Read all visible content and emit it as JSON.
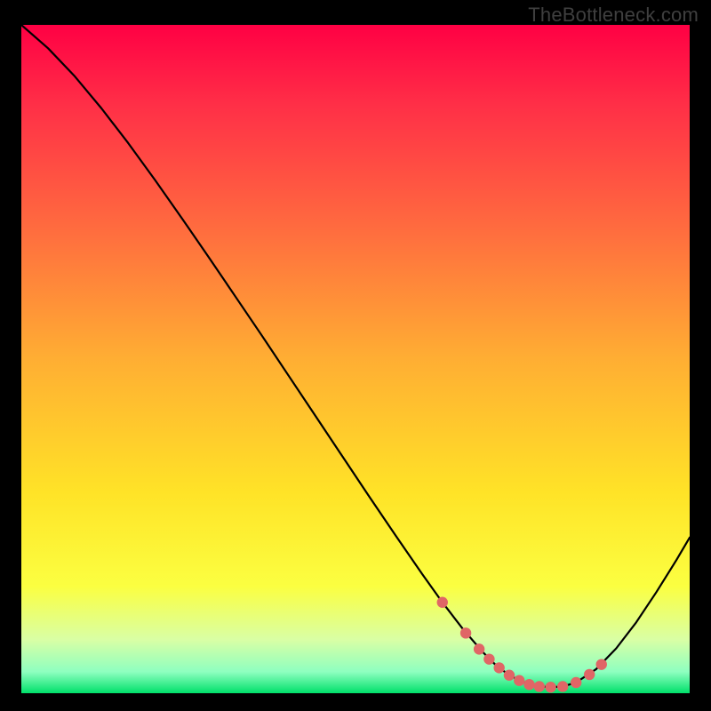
{
  "watermark": "TheBottleneck.com",
  "colors": {
    "dot_fill": "#e06666",
    "curve_stroke": "#000000",
    "gradient_stops": [
      {
        "offset": "0%",
        "color": "#ff0044"
      },
      {
        "offset": "12%",
        "color": "#ff2f47"
      },
      {
        "offset": "30%",
        "color": "#ff6a3f"
      },
      {
        "offset": "50%",
        "color": "#ffae33"
      },
      {
        "offset": "70%",
        "color": "#ffe327"
      },
      {
        "offset": "84%",
        "color": "#fbff41"
      },
      {
        "offset": "92%",
        "color": "#d9ffa5"
      },
      {
        "offset": "96.8%",
        "color": "#8effc0"
      },
      {
        "offset": "100%",
        "color": "#00e06a"
      }
    ]
  },
  "chart_data": {
    "type": "line",
    "title": "",
    "xlabel": "",
    "ylabel": "",
    "xlim": [
      0,
      100
    ],
    "ylim": [
      0,
      100
    ],
    "series": [
      {
        "name": "curve",
        "x": [
          0,
          4,
          8,
          12,
          16,
          20,
          24,
          28,
          32,
          36,
          40,
          44,
          48,
          52,
          56,
          60,
          63,
          66,
          69,
          71,
          73,
          75,
          77,
          79,
          81,
          83,
          86,
          89,
          92,
          95,
          98,
          100
        ],
        "y": [
          100,
          96.5,
          92.3,
          87.5,
          82.3,
          76.8,
          71.1,
          65.3,
          59.4,
          53.5,
          47.5,
          41.5,
          35.5,
          29.5,
          23.6,
          17.8,
          13.6,
          9.7,
          6.2,
          4.2,
          2.7,
          1.7,
          1.1,
          0.9,
          1.0,
          1.6,
          3.6,
          6.7,
          10.6,
          15.1,
          19.9,
          23.3
        ]
      }
    ],
    "highlight_points": {
      "name": "sweet-spot",
      "x": [
        63.0,
        66.5,
        68.5,
        70.0,
        71.5,
        73.0,
        74.5,
        76.0,
        77.5,
        79.2,
        81.0,
        83.0,
        85.0,
        86.8
      ],
      "y": [
        13.6,
        9.0,
        6.6,
        5.1,
        3.8,
        2.7,
        1.9,
        1.3,
        1.0,
        0.9,
        1.0,
        1.6,
        2.8,
        4.3
      ]
    }
  }
}
